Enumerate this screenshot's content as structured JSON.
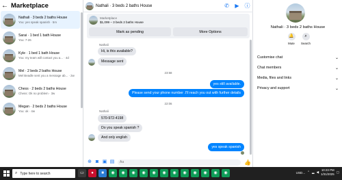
{
  "sidebar": {
    "title": "Marketplace",
    "conversations": [
      {
        "title": "Nathali · 3 beds 2 baths House",
        "subtitle": "You: yes speak spanish · 5m",
        "active": true
      },
      {
        "title": "Sarai · 1 bed 1 bath House",
        "subtitle": "You: 7-26",
        "active": false
      },
      {
        "title": "Kyle · 1 bed 1 bath House",
        "subtitle": "You: my team will contact you a... · 4d",
        "active": false
      },
      {
        "title": "Mel · 2 beds 2 baths House",
        "subtitle": "Mel Beadle sent you a message ab... · 2w",
        "active": false
      },
      {
        "title": "Chess · 2 beds 2 baths House",
        "subtitle": "Chess: Ok no problem · 3w",
        "active": false
      },
      {
        "title": "Megan · 2 beds 2 baths House",
        "subtitle": "You: ok · 4w",
        "active": false
      }
    ]
  },
  "chat": {
    "title": "Nathali · 3 beds 2 baths House",
    "marketplace_card": {
      "label": "Marketplace",
      "price": "$1,099 – 3 beds 2 baths House",
      "pending_button": "Mark as pending",
      "options_button": "More Options"
    },
    "messages": {
      "sender1": "Nathali",
      "m1": "Hi, is this available?",
      "m2": "Message sent",
      "time1": "23:58",
      "m3": "yes still available.",
      "m4": "Please send your phone number .I'll reach you out with further details",
      "time2": "22:06",
      "sender2": "Nathali",
      "m5": "570-972-4198",
      "m6": "Do you speak spanish ?",
      "m7": "And only english",
      "m8": "yes speak spanish"
    },
    "compose_placeholder": "Aa"
  },
  "details": {
    "name": "Nathali · 3 beds 2 baths House",
    "actions": [
      {
        "label": "Mute",
        "icon": "bell-icon"
      },
      {
        "label": "Search",
        "icon": "search-icon"
      }
    ],
    "sections": [
      "Customise chat",
      "Chat members",
      "Media, files and links",
      "Privacy and support"
    ]
  },
  "taskbar": {
    "search_placeholder": "Type here to search",
    "tray_label": "USD...",
    "time": "10:23 PM",
    "date": "1/31/2025"
  },
  "colors": {
    "accent": "#1877f2",
    "outgoing_bubble": "#0084ff",
    "incoming_bubble": "#e4e6eb",
    "taskbar": "#202020"
  }
}
